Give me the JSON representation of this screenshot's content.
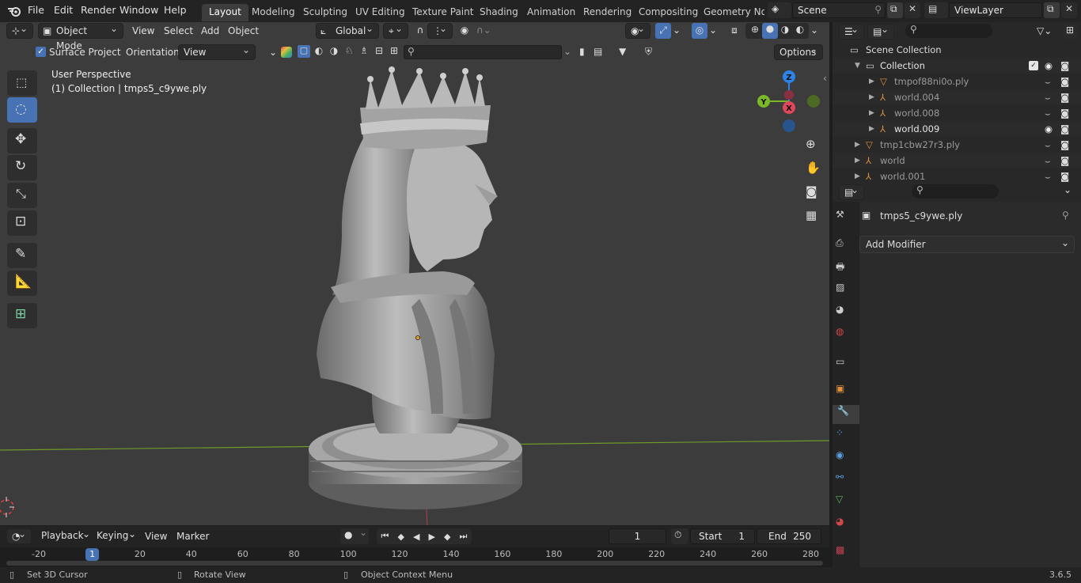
{
  "topbar": {
    "menus": [
      "File",
      "Edit",
      "Render",
      "Window",
      "Help"
    ],
    "workspaces": [
      "Layout",
      "Modeling",
      "Sculpting",
      "UV Editing",
      "Texture Paint",
      "Shading",
      "Animation",
      "Rendering",
      "Compositing",
      "Geometry Noc"
    ],
    "active_workspace": "Layout",
    "scene_value": "Scene",
    "viewlayer_value": "ViewLayer"
  },
  "viewport_header": {
    "mode": "Object Mode",
    "menus": [
      "View",
      "Select",
      "Add",
      "Object"
    ],
    "transform_orientation": "Global"
  },
  "tool_settings": {
    "surface_project_label": "Surface Project",
    "surface_project_checked": true,
    "orientation_label": "Orientation:",
    "orientation_value": "View",
    "options_label": "Options"
  },
  "viewport": {
    "perspective_label": "User Perspective",
    "object_label": "(1) Collection | tmps5_c9ywe.ply",
    "gizmo_axes": [
      "Z",
      "Y",
      "X"
    ]
  },
  "timeline": {
    "menus": [
      "Playback",
      "Keying",
      "View",
      "Marker"
    ],
    "current_frame": "1",
    "start_label": "Start",
    "start_value": "1",
    "end_label": "End",
    "end_value": "250",
    "ruler_ticks": [
      "-20",
      "1",
      "20",
      "40",
      "60",
      "80",
      "100",
      "120",
      "140",
      "160",
      "180",
      "200",
      "220",
      "240",
      "260",
      "280"
    ],
    "active_tick": "1"
  },
  "statusbar": {
    "hint1": "Set 3D Cursor",
    "hint2": "Rotate View",
    "hint3": "Object Context Menu",
    "version": "3.6.5"
  },
  "outliner": {
    "root": "Scene Collection",
    "items": [
      {
        "label": "Collection",
        "type": "collection",
        "indent": 1,
        "visible": true
      },
      {
        "label": "tmpof88ni0o.ply",
        "type": "mesh",
        "indent": 2,
        "visible": false
      },
      {
        "label": "world.004",
        "type": "empty",
        "indent": 2,
        "visible": false
      },
      {
        "label": "world.008",
        "type": "empty",
        "indent": 2,
        "visible": false
      },
      {
        "label": "world.009",
        "type": "empty",
        "indent": 2,
        "visible": true
      },
      {
        "label": "tmp1cbw27r3.ply",
        "type": "mesh",
        "indent": 1,
        "visible": false
      },
      {
        "label": "world",
        "type": "empty",
        "indent": 1,
        "visible": false
      },
      {
        "label": "world.001",
        "type": "empty",
        "indent": 1,
        "visible": false
      }
    ]
  },
  "properties": {
    "object_name": "tmps5_c9ywe.ply",
    "add_modifier_label": "Add Modifier"
  },
  "colors": {
    "accent": "#4772b3",
    "axis_x": "#e0465a",
    "axis_y": "#7ab829",
    "axis_z": "#2e83e6",
    "empty_orange": "#e08f3c",
    "mesh_green": "#57b56c"
  }
}
